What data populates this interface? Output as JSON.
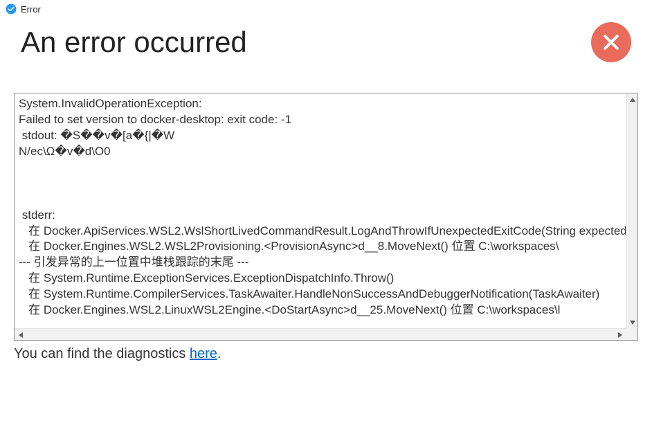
{
  "titlebar": {
    "label": "Error"
  },
  "header": {
    "title": "An error occurred"
  },
  "error": {
    "text": "System.InvalidOperationException:\nFailed to set version to docker-desktop: exit code: -1\n stdout: �S��v�[a�{|�W\nN/ec\\Ω�v�d\\O0\n\n\n\n stderr: \n   在 Docker.ApiServices.WSL2.WslShortLivedCommandResult.LogAndThrowIfUnexpectedExitCode(String expected)\n   在 Docker.Engines.WSL2.WSL2Provisioning.<ProvisionAsync>d__8.MoveNext() 位置 C:\\workspaces\\\n--- 引发异常的上一位置中堆栈跟踪的末尾 ---\n   在 System.Runtime.ExceptionServices.ExceptionDispatchInfo.Throw()\n   在 System.Runtime.CompilerServices.TaskAwaiter.HandleNonSuccessAndDebuggerNotification(TaskAwaiter)\n   在 Docker.Engines.WSL2.LinuxWSL2Engine.<DoStartAsync>d__25.MoveNext() 位置 C:\\workspaces\\l"
  },
  "footer": {
    "prefix": "You can find the diagnostics ",
    "link": "here",
    "suffix": "."
  }
}
